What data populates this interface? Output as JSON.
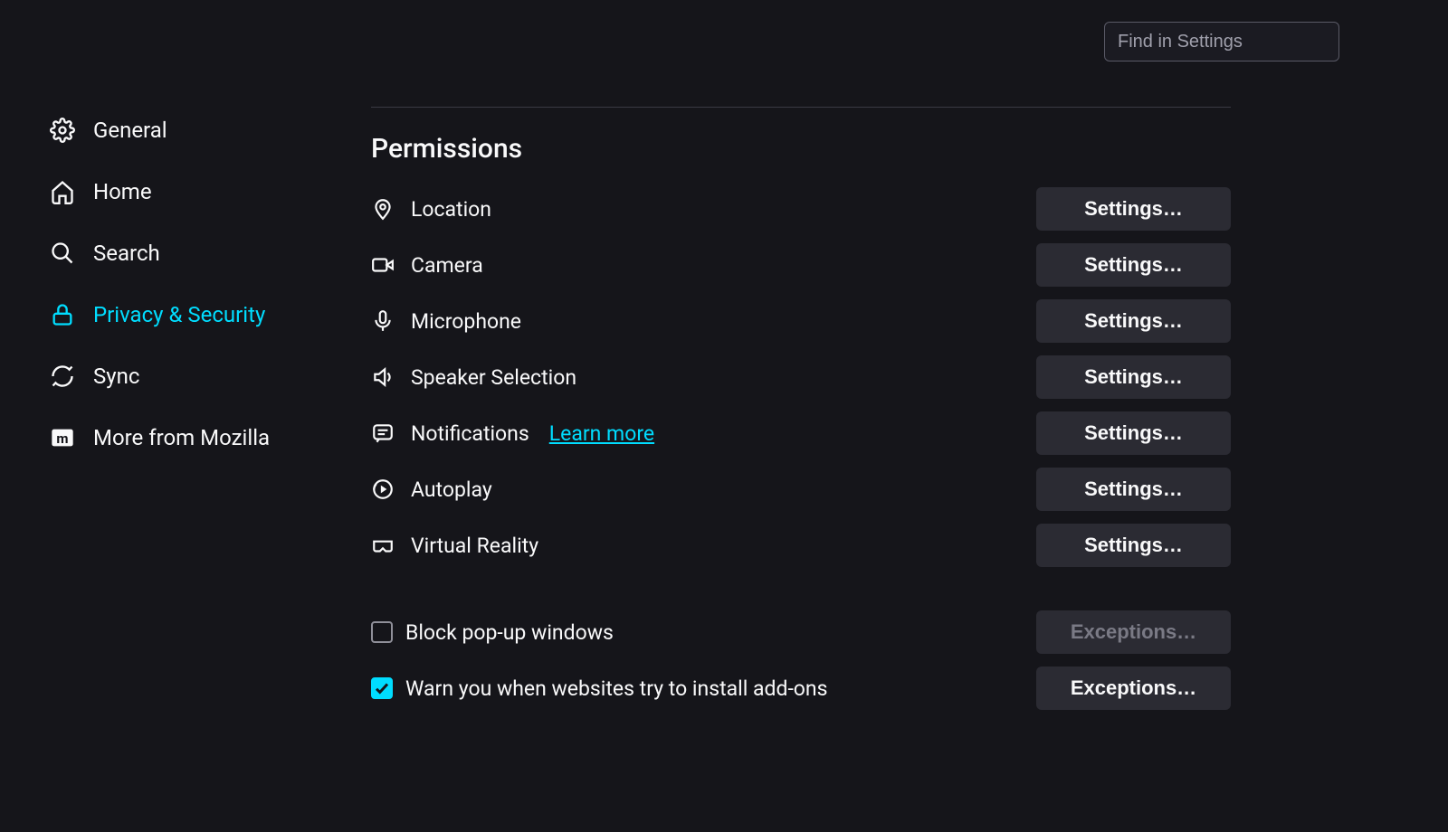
{
  "search": {
    "placeholder": "Find in Settings"
  },
  "sidebar": {
    "items": [
      {
        "label": "General"
      },
      {
        "label": "Home"
      },
      {
        "label": "Search"
      },
      {
        "label": "Privacy & Security"
      },
      {
        "label": "Sync"
      },
      {
        "label": "More from Mozilla"
      }
    ]
  },
  "section": {
    "title": "Permissions"
  },
  "permissions": [
    {
      "label": "Location",
      "button": "Settings…"
    },
    {
      "label": "Camera",
      "button": "Settings…"
    },
    {
      "label": "Microphone",
      "button": "Settings…"
    },
    {
      "label": "Speaker Selection",
      "button": "Settings…"
    },
    {
      "label": "Notifications",
      "link": "Learn more",
      "button": "Settings…"
    },
    {
      "label": "Autoplay",
      "button": "Settings…"
    },
    {
      "label": "Virtual Reality",
      "button": "Settings…"
    }
  ],
  "checkboxes": [
    {
      "label": "Block pop-up windows",
      "checked": false,
      "button": "Exceptions…",
      "button_enabled": false
    },
    {
      "label": "Warn you when websites try to install add-ons",
      "checked": true,
      "button": "Exceptions…",
      "button_enabled": true
    }
  ]
}
